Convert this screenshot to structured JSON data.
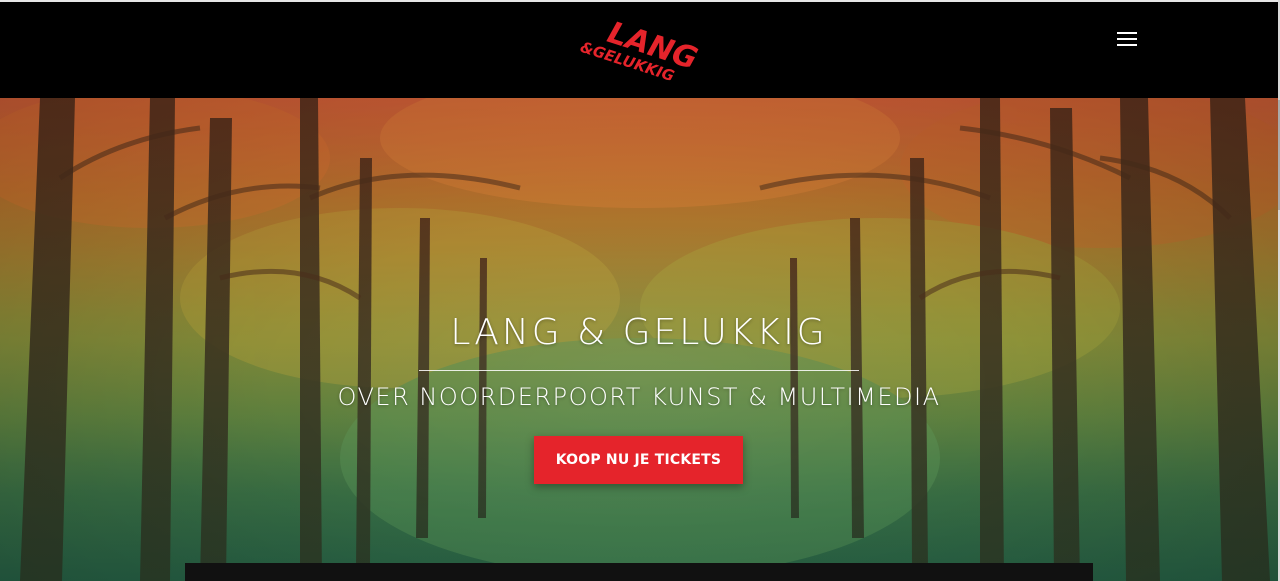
{
  "navbar": {
    "logo_text_top": "LANG",
    "logo_text_bottom": "&GELUKKIG",
    "menu_icon": "hamburger-menu-icon"
  },
  "hero": {
    "title": "LANG & GELUKKIG",
    "subtitle": "OVER NOORDERPOORT KUNST & MULTIMEDIA",
    "cta_label": "KOOP NU JE TICKETS"
  },
  "colors": {
    "accent": "#e5242b",
    "navbar_bg": "#000000",
    "text": "#ffffff"
  }
}
